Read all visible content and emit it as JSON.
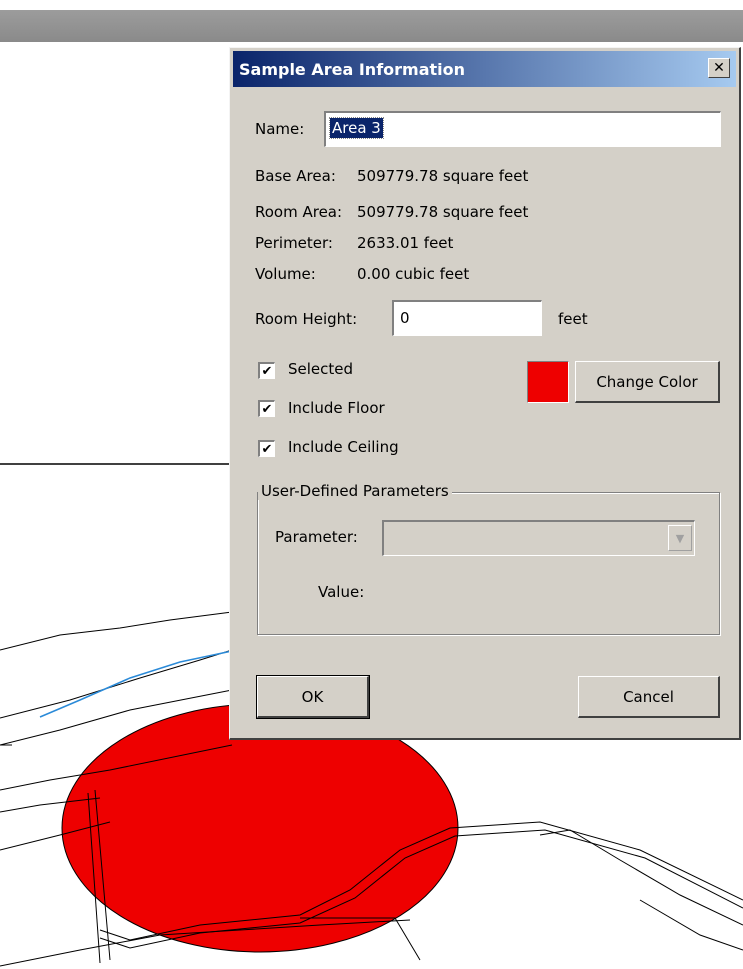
{
  "dialog": {
    "title": "Sample Area Information",
    "close_glyph": "✕",
    "name_label": "Name:",
    "name_value": "Area 3",
    "base_area_label": "Base Area:",
    "base_area_value": "509779.78 square feet",
    "room_area_label": "Room Area:",
    "room_area_value": "509779.78 square feet",
    "perimeter_label": "Perimeter:",
    "perimeter_value": "2633.01 feet",
    "volume_label": "Volume:",
    "volume_value": "0.00 cubic feet",
    "room_height_label": "Room Height:",
    "room_height_value": "0",
    "room_height_unit": "feet",
    "checkboxes": [
      {
        "label": "Selected",
        "checked": true
      },
      {
        "label": "Include Floor",
        "checked": true
      },
      {
        "label": "Include Ceiling",
        "checked": true
      }
    ],
    "check_glyph": "✔",
    "area_color": "#ee0000",
    "change_color_label": "Change Color",
    "group_title": "User-Defined Parameters",
    "parameter_label": "Parameter:",
    "parameter_value": "",
    "value_label": "Value:",
    "ok_label": "OK",
    "cancel_label": "Cancel"
  },
  "colors": {
    "dialog_face": "#d4d0c8",
    "title_start": "#0a246a",
    "title_end": "#a6caf0",
    "area_fill": "#ee0000",
    "blue_line": "#2a8ad8"
  }
}
